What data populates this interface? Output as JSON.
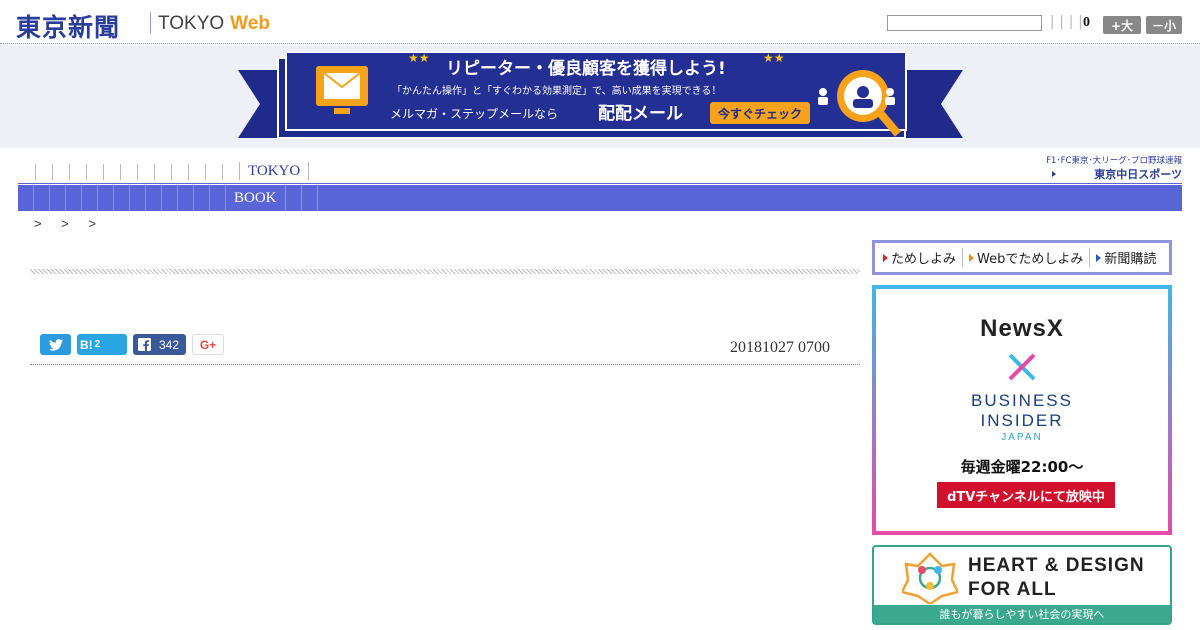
{
  "header": {
    "logo_jp": "東京新聞",
    "logo_tokyo": "TOKYO",
    "logo_web": "Web",
    "search": {
      "placeholder": "",
      "value": ""
    },
    "bars": "||||",
    "count": "0",
    "size_large": "+大",
    "size_small": "－小"
  },
  "banner": {
    "headline": "リピーター・優良顧客を獲得しよう!",
    "subline": "「かんたん操作」と「すぐわかる効果測定」で、高い成果を実現できる！",
    "product_line": "メルマガ・ステップメールなら",
    "brand": "配配メール",
    "cta": "今すぐチェック"
  },
  "nav": {
    "primary_active": "TOKYO",
    "secondary_active": "BOOK",
    "chunichi_line1": "F1･FC東京･大リーグ･プロ野球速報",
    "chunichi_line2": "東京中日スポーツ"
  },
  "breadcrumb": "> > >",
  "article": {
    "date": "20181027 0700",
    "share": {
      "hatena_label": "B!",
      "hatena_count": "2",
      "facebook_count": "342",
      "gplus_label": "G+"
    }
  },
  "sidebar": {
    "subscribe": [
      {
        "label": "ためしよみ",
        "color": "#d0262b"
      },
      {
        "label": "Webでためしよみ",
        "color": "#f08a1c"
      },
      {
        "label": "新聞購読",
        "color": "#2a5ed0"
      }
    ],
    "ad_newsx": {
      "title": "NewsX",
      "partner_line1": "BUSINESS",
      "partner_line2": "INSIDER",
      "partner_line3": "JAPAN",
      "schedule": "毎週金曜22:00～",
      "channel": "dTVチャンネルにて放映中"
    },
    "ad_heart": {
      "line1": "HEART & DESIGN",
      "line2": "FOR ALL",
      "sub": "誰もが暮らしやすい社会の実現へ"
    }
  }
}
